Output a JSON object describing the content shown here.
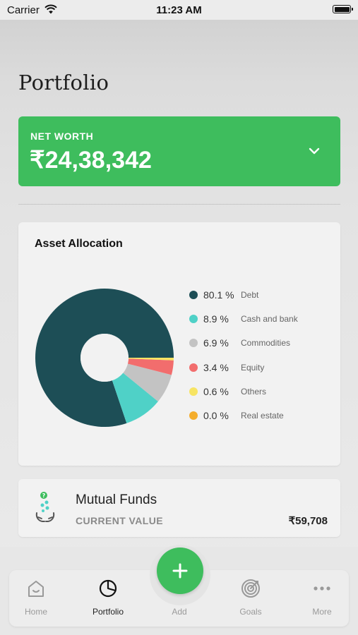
{
  "status_bar": {
    "carrier": "Carrier",
    "time": "11:23 AM"
  },
  "page": {
    "title": "Portfolio"
  },
  "net_worth": {
    "label": "NET WORTH",
    "value": "₹24,38,342"
  },
  "asset_allocation": {
    "title": "Asset Allocation",
    "items": [
      {
        "percent": "80.1 %",
        "label": "Debt",
        "color": "#1d4e56"
      },
      {
        "percent": "8.9 %",
        "label": "Cash and bank",
        "color": "#4fd1c7"
      },
      {
        "percent": "6.9 %",
        "label": "Commodities",
        "color": "#c3c3c3"
      },
      {
        "percent": "3.4 %",
        "label": "Equity",
        "color": "#f26d6d"
      },
      {
        "percent": "0.6 %",
        "label": "Others",
        "color": "#f7e463"
      },
      {
        "percent": "0.0 %",
        "label": "Real estate",
        "color": "#f4ad2c"
      }
    ]
  },
  "chart_data": {
    "type": "pie",
    "title": "Asset Allocation",
    "donut": true,
    "categories": [
      "Debt",
      "Cash and bank",
      "Commodities",
      "Equity",
      "Others",
      "Real estate"
    ],
    "values": [
      80.1,
      8.9,
      6.9,
      3.4,
      0.6,
      0.0
    ],
    "colors": [
      "#1d4e56",
      "#4fd1c7",
      "#c3c3c3",
      "#f26d6d",
      "#f7e463",
      "#f4ad2c"
    ],
    "legend": "right"
  },
  "mutual_funds": {
    "title": "Mutual Funds",
    "subtitle": "CURRENT VALUE",
    "value": "₹59,708",
    "icon": "mutual-funds-icon"
  },
  "tab_bar": {
    "items": [
      {
        "label": "Home",
        "icon": "home-icon"
      },
      {
        "label": "Portfolio",
        "icon": "pie-chart-icon",
        "active": true
      },
      {
        "label": "Add",
        "icon": "plus-icon"
      },
      {
        "label": "Goals",
        "icon": "target-icon"
      },
      {
        "label": "More",
        "icon": "more-icon"
      }
    ]
  },
  "colors": {
    "accent": "#3ebd5d"
  }
}
